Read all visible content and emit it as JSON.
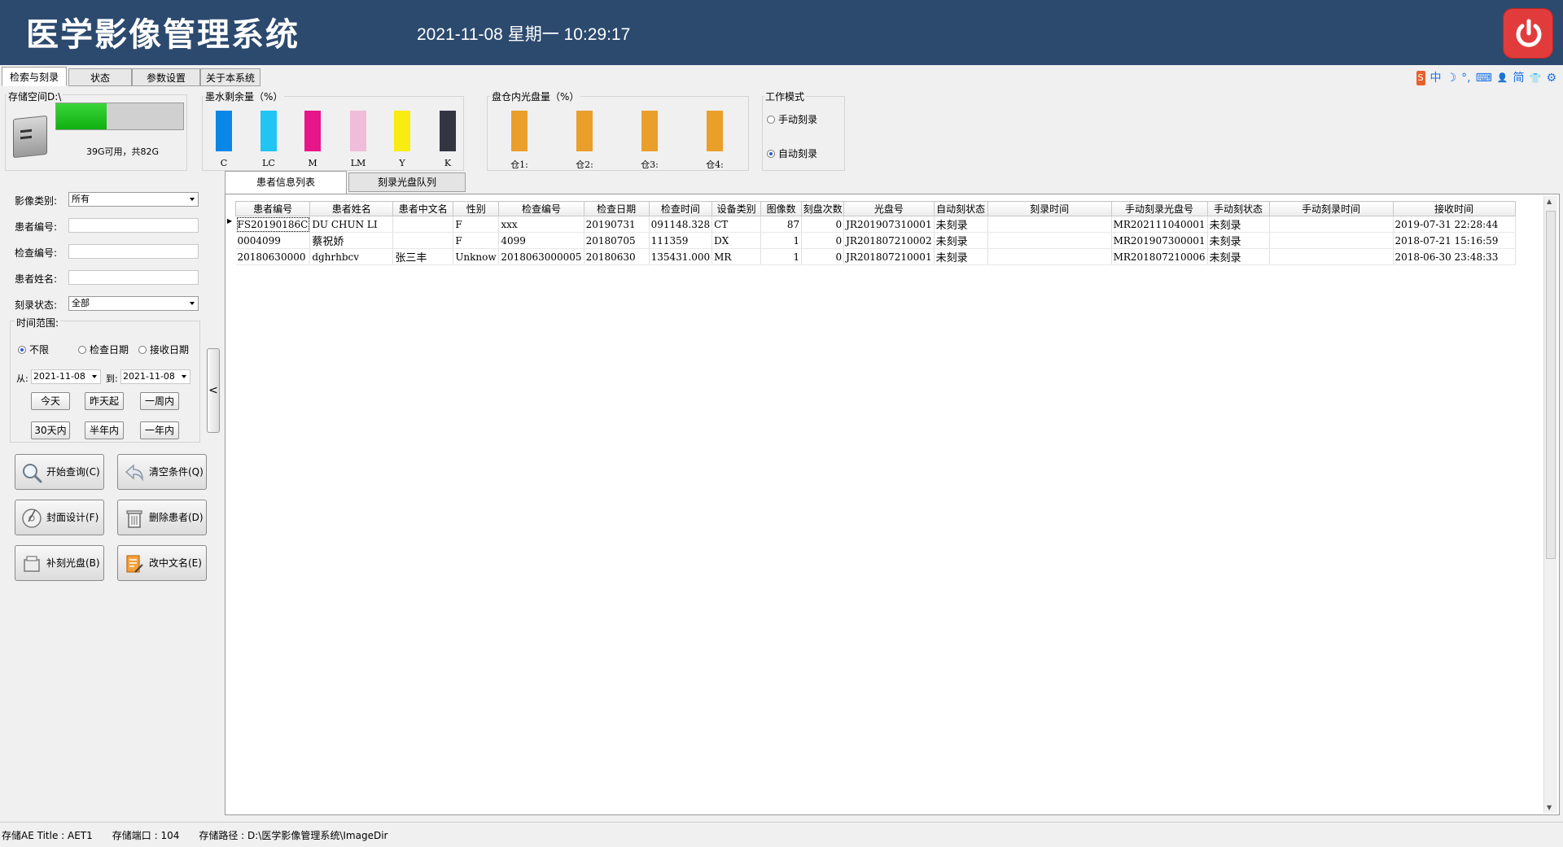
{
  "header": {
    "title": "医学影像管理系统",
    "datetime": "2021-11-08 星期一 10:29:17"
  },
  "main_tabs": [
    {
      "label": "检索与刻录",
      "active": true
    },
    {
      "label": "状态",
      "active": false
    },
    {
      "label": "参数设置",
      "active": false
    },
    {
      "label": "关于本系统",
      "active": false
    }
  ],
  "tray_icons": [
    "sogou-ime-icon",
    "chinese-mode-icon",
    "moon-icon",
    "punctuation-icon",
    "keyboard-icon",
    "user-icon",
    "simplified-icon",
    "shirt-icon",
    "gear-icon"
  ],
  "tray_text": {
    "ime": "S",
    "cn": "中",
    "moon": "☽",
    "punct": "°,",
    "kbd": "⌨",
    "user": "👤",
    "simp": "简",
    "shirt": "👕",
    "gear": "⚙"
  },
  "storage": {
    "title": "存储空间D:\\",
    "usage_text": "39G可用，共82G",
    "fill_fraction": 0.4
  },
  "ink": {
    "title": "墨水剩余量（%）",
    "colors": [
      {
        "label": "C",
        "color": "#0a86e6",
        "level": 1.0
      },
      {
        "label": "LC",
        "color": "#22c4f4",
        "level": 1.0
      },
      {
        "label": "M",
        "color": "#e8148a",
        "level": 1.0
      },
      {
        "label": "LM",
        "color": "#efbcd9",
        "level": 1.0
      },
      {
        "label": "Y",
        "color": "#f8ec10",
        "level": 1.0
      },
      {
        "label": "K",
        "color": "#353542",
        "level": 1.0
      }
    ]
  },
  "discs": {
    "title": "盘仓内光盘量（%）",
    "bins": [
      {
        "label": "仓1:",
        "color": "#ea9f2b",
        "level": 1.0
      },
      {
        "label": "仓2:",
        "color": "#ea9f2b",
        "level": 1.0
      },
      {
        "label": "仓3:",
        "color": "#ea9f2b",
        "level": 1.0
      },
      {
        "label": "仓4:",
        "color": "#ea9f2b",
        "level": 1.0
      }
    ]
  },
  "work_mode": {
    "title": "工作模式",
    "manual": "手动刻录",
    "auto": "自动刻录",
    "selected": "auto"
  },
  "filters": {
    "image_type_label": "影像类别:",
    "image_type_value": "所有",
    "patient_id_label": "患者编号:",
    "exam_id_label": "检查编号:",
    "patient_name_label": "患者姓名:",
    "burn_status_label": "刻录状态:",
    "burn_status_value": "全部",
    "time_range_label": "时间范围:",
    "time_opts": {
      "unlimited": "不限",
      "exam_date": "检查日期",
      "receive_date": "接收日期"
    },
    "from_label": "从:",
    "from_value": "2021-11-08",
    "to_label": "到:",
    "to_value": "2021-11-08",
    "quick_buttons": [
      "今天",
      "昨天起",
      "一周内",
      "30天内",
      "半年内",
      "一年内"
    ]
  },
  "actions": {
    "query": "开始查询(C)",
    "clear": "清空条件(Q)",
    "cover": "封面设计(F)",
    "delete": "删除患者(D)",
    "reburn": "补刻光盘(B)",
    "rename": "改中文名(E)"
  },
  "collapse_glyph": "<",
  "sub_tabs": [
    {
      "label": "患者信息列表",
      "active": true
    },
    {
      "label": "刻录光盘队列",
      "active": false
    }
  ],
  "grid": {
    "columns": [
      "患者编号",
      "患者姓名",
      "患者中文名",
      "性别",
      "检查编号",
      "检查日期",
      "检查时间",
      "设备类别",
      "图像数",
      "刻盘次数",
      "光盘号",
      "自动刻状态",
      "刻录时间",
      "手动刻录光盘号",
      "手动刻状态",
      "手动刻录时间",
      "接收时间"
    ],
    "rows": [
      [
        "FS20190186C",
        "DU CHUN LI",
        "",
        "F",
        "xxx",
        "20190731",
        "091148.328",
        "CT",
        "87",
        "0",
        "JR201907310001",
        "未刻录",
        "",
        "MR202111040001",
        "未刻录",
        "",
        "2019-07-31 22:28:44"
      ],
      [
        "0004099",
        "蔡祝娇",
        "",
        "F",
        "4099",
        "20180705",
        "111359",
        "DX",
        "1",
        "0",
        "JR201807210002",
        "未刻录",
        "",
        "MR201907300001",
        "未刻录",
        "",
        "2018-07-21 15:16:59"
      ],
      [
        "20180630000",
        "dghrhbcv",
        "张三丰",
        "Unknow",
        "2018063000005",
        "20180630",
        "135431.000",
        "MR",
        "1",
        "0",
        "JR201807210001",
        "未刻录",
        "",
        "MR201807210006",
        "未刻录",
        "",
        "2018-06-30 23:48:33"
      ]
    ]
  },
  "status_bar": {
    "ae_title": "存储AE Title : AET1",
    "port": "存储端口 : 104",
    "path": "存储路径 : D:\\医学影像管理系统\\ImageDir"
  }
}
